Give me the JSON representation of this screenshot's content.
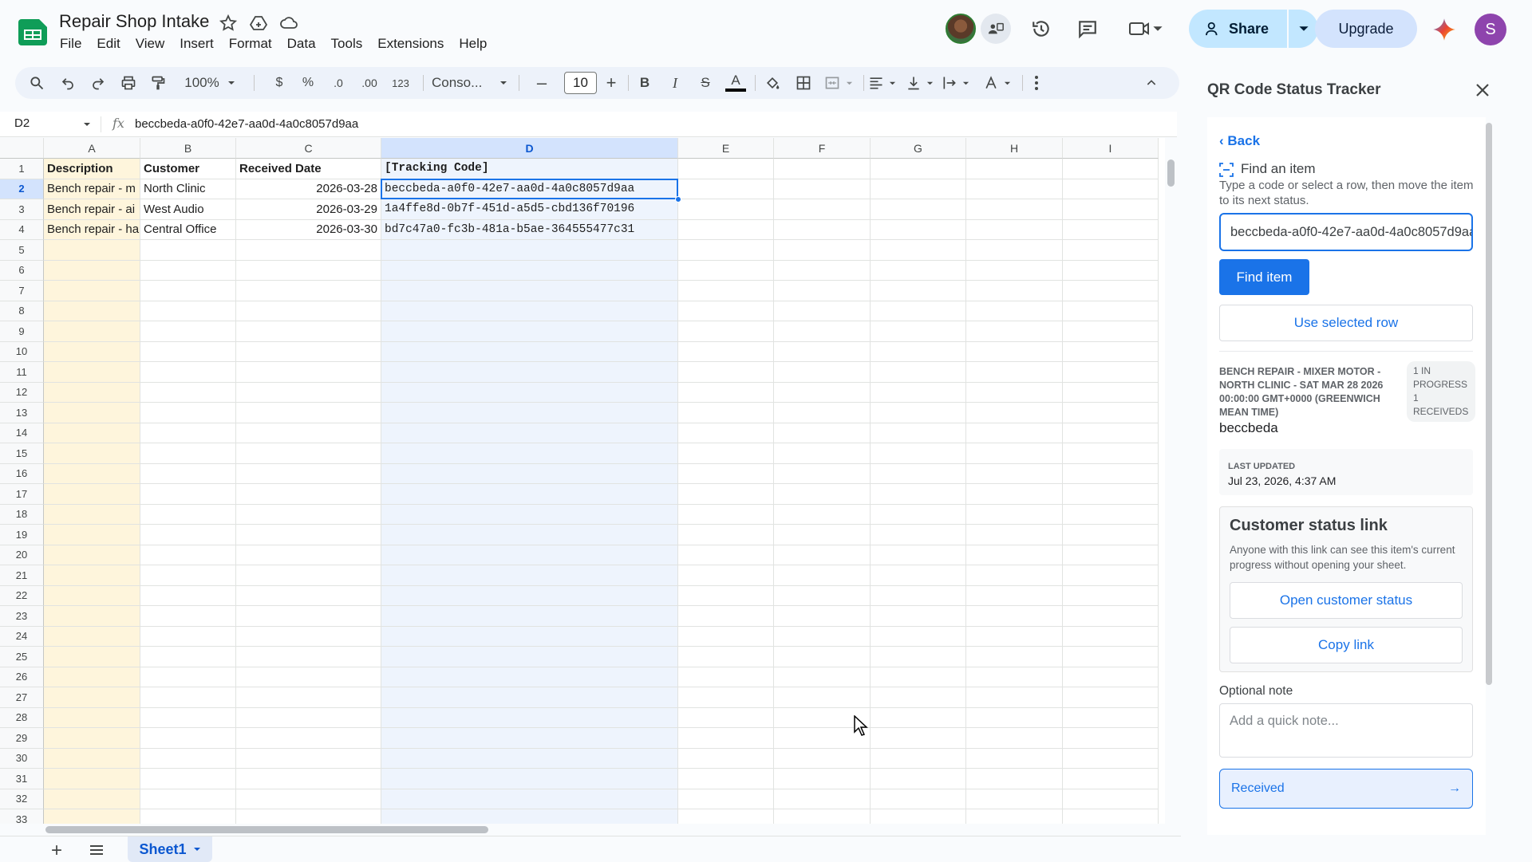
{
  "header": {
    "title": "Repair Shop Intake",
    "menu": [
      "File",
      "Edit",
      "View",
      "Insert",
      "Format",
      "Data",
      "Tools",
      "Extensions",
      "Help"
    ],
    "share_label": "Share",
    "upgrade_label": "Upgrade",
    "profile_initial": "S"
  },
  "toolbar": {
    "zoom": "100%",
    "currency": "$",
    "percent": "%",
    "dec_decrease": ".0",
    "dec_increase": ".00",
    "number_format": "123",
    "font": "Conso...",
    "font_size": "10",
    "bold": "B",
    "italic": "I",
    "strike": "S",
    "text_color": "A"
  },
  "formula_bar": {
    "cell_ref": "D2",
    "fx": "fx",
    "value": "beccbeda-a0f0-42e7-aa0d-4a0c8057d9aa"
  },
  "grid": {
    "columns": [
      "A",
      "B",
      "C",
      "D",
      "E",
      "F",
      "G",
      "H",
      "I"
    ],
    "row_numbers": [
      "1",
      "2",
      "3",
      "4",
      "5",
      "6",
      "7",
      "8",
      "9",
      "10",
      "11",
      "12",
      "13",
      "14",
      "15",
      "16",
      "17",
      "18",
      "19",
      "20",
      "21",
      "22",
      "23",
      "24",
      "25",
      "26",
      "27",
      "28",
      "29",
      "30",
      "31",
      "32",
      "33"
    ],
    "headers": [
      "Description",
      "Customer",
      "Received Date",
      "[Tracking Code]"
    ],
    "rows": [
      [
        "Bench repair - m",
        "North Clinic",
        "2026-03-28",
        "beccbeda-a0f0-42e7-aa0d-4a0c8057d9aa"
      ],
      [
        "Bench repair - ai",
        "West Audio",
        "2026-03-29",
        "1a4ffe8d-0b7f-451d-a5d5-cbd136f70196"
      ],
      [
        "Bench repair - ha",
        "Central Office",
        "2026-03-30",
        "bd7c47a0-fc3b-481a-b5ae-364555477c31"
      ]
    ],
    "selected_cell": "D2"
  },
  "sheets": {
    "active": "Sheet1"
  },
  "panel": {
    "title": "QR Code Status Tracker",
    "back_label": "‹ Back",
    "find_heading": "Find an item",
    "find_help": "Type a code or select a row, then move the item to its next status.",
    "code_value": "beccbeda-a0f0-42e7-aa0d-4a0c8057d9aa",
    "find_button": "Find item",
    "use_row_button": "Use selected row",
    "item_title": "Bench repair - mixer motor - North Clinic - Sat Mar 28 2026 00:00:00 GMT+0000 (Greenwich Mean Time)",
    "status_chip": "1 in progress 1 receiveds",
    "item_code": "beccbeda",
    "last_updated_label": "Last updated",
    "last_updated_value": "Jul 23, 2026, 4:37 AM",
    "customer_heading": "Customer status link",
    "customer_help": "Anyone with this link can see this item's current progress without opening your sheet.",
    "open_status_button": "Open customer status",
    "copy_link_button": "Copy link",
    "note_label": "Optional note",
    "note_placeholder": "Add a quick note...",
    "next_status_button": "Received",
    "next_status_arrow": "→"
  },
  "colors": {
    "accent": "#1a73e8",
    "share_bg": "#c2e7ff",
    "col_a_highlight": "#fef5dc",
    "col_d_highlight": "#eef4fd"
  },
  "icons": [
    "sheets-logo-icon",
    "star-icon",
    "move-to-drive-icon",
    "cloud-status-icon",
    "present-icon",
    "history-icon",
    "comment-icon",
    "video-call-icon",
    "person-add-icon",
    "gemini-icon",
    "search-icon",
    "undo-icon",
    "redo-icon",
    "print-icon",
    "paint-format-icon",
    "fill-color-icon",
    "borders-icon",
    "merge-cells-icon",
    "align-icon",
    "valign-icon",
    "text-wrap-icon",
    "text-rotate-icon",
    "more-icon",
    "collapse-icon",
    "close-icon",
    "qr-scan-icon"
  ]
}
